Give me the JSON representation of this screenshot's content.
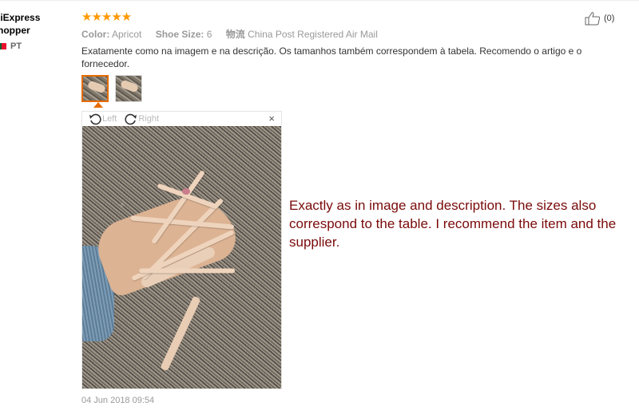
{
  "reviewer": {
    "name_line1": "liExpress",
    "name_line2": "hopper",
    "country": "PT"
  },
  "review": {
    "rating": 5,
    "stars": "★★★★★",
    "meta": {
      "color_label": "Color:",
      "color_value": "Apricot",
      "size_label": "Shoe Size:",
      "size_value": "6",
      "shipping_label": "物流",
      "shipping_value": "China Post Registered Air Mail"
    },
    "text": "Exatamente como na imagem e na descrição. Os tamanhos também correspondem à tabela. Recomendo o artigo e o fornecedor.",
    "helpful_count": "(0)",
    "date": "04 Jun 2018 09:54"
  },
  "viewer": {
    "rotate_left": "Left",
    "rotate_right": "Right",
    "close": "×"
  },
  "translation_overlay": {
    "text": "Exactly as in image and description. The sizes also correspond to the table. I recommend the item and the supplier."
  },
  "colors": {
    "star": "#ff9900",
    "active_thumb_border": "#e66c00",
    "translation_text": "#7a0a0a"
  }
}
